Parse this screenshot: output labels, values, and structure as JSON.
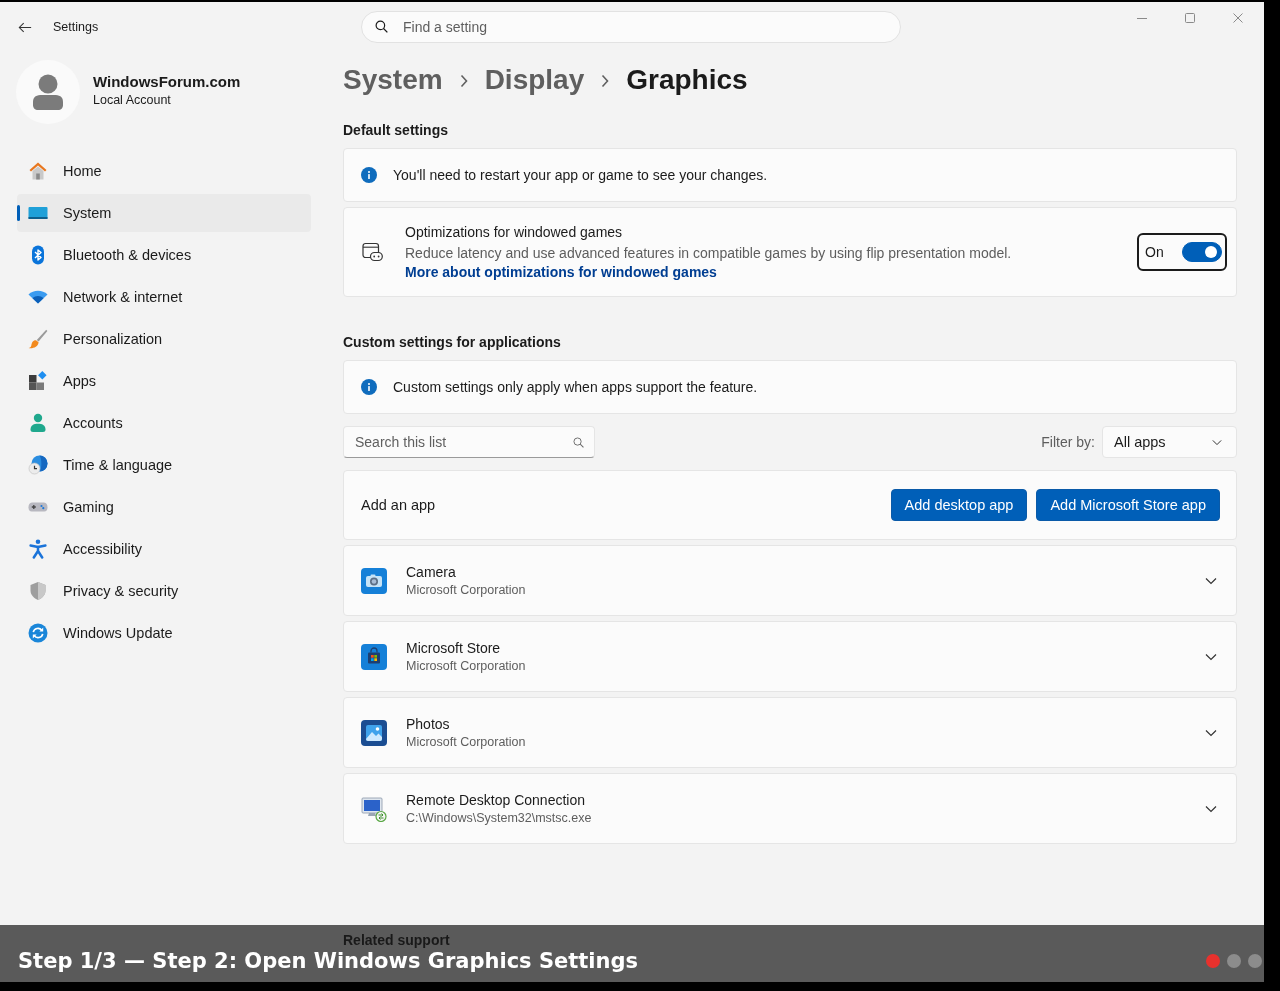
{
  "window": {
    "title": "Settings",
    "search": {
      "placeholder": "Find a setting"
    }
  },
  "account": {
    "name": "WindowsForum.com",
    "type": "Local Account"
  },
  "sidebar": {
    "items": [
      {
        "label": "Home",
        "selected": false
      },
      {
        "label": "System",
        "selected": true
      },
      {
        "label": "Bluetooth & devices",
        "selected": false
      },
      {
        "label": "Network & internet",
        "selected": false
      },
      {
        "label": "Personalization",
        "selected": false
      },
      {
        "label": "Apps",
        "selected": false
      },
      {
        "label": "Accounts",
        "selected": false
      },
      {
        "label": "Time & language",
        "selected": false
      },
      {
        "label": "Gaming",
        "selected": false
      },
      {
        "label": "Accessibility",
        "selected": false
      },
      {
        "label": "Privacy & security",
        "selected": false
      },
      {
        "label": "Windows Update",
        "selected": false
      }
    ]
  },
  "breadcrumb": [
    {
      "label": "System",
      "current": false
    },
    {
      "label": "Display",
      "current": false
    },
    {
      "label": "Graphics",
      "current": true
    }
  ],
  "default_settings": {
    "heading": "Default settings",
    "notice": "You'll need to restart your app or game to see your changes.",
    "setting": {
      "title": "Optimizations for windowed games",
      "description": "Reduce latency and use advanced features in compatible games by using flip presentation model.",
      "link": "More about optimizations for windowed games",
      "toggle": {
        "label": "On",
        "on": true,
        "focused": true
      }
    }
  },
  "custom_settings": {
    "heading": "Custom settings for applications",
    "notice": "Custom settings only apply when apps support the feature.",
    "search": {
      "placeholder": "Search this list"
    },
    "filter": {
      "label": "Filter by:",
      "value": "All apps"
    },
    "add_app": {
      "label": "Add an app",
      "buttons": [
        "Add desktop app",
        "Add Microsoft Store app"
      ]
    },
    "apps": [
      {
        "name": "Camera",
        "detail": "Microsoft Corporation",
        "expanded": false
      },
      {
        "name": "Microsoft Store",
        "detail": "Microsoft Corporation",
        "expanded": false
      },
      {
        "name": "Photos",
        "detail": "Microsoft Corporation",
        "expanded": false
      },
      {
        "name": "Remote Desktop Connection",
        "detail": "C:\\Windows\\System32\\mstsc.exe",
        "expanded": false
      }
    ]
  },
  "related_support": {
    "heading": "Related support"
  },
  "caption": {
    "text": "Step 1/3 — Step 2: Open Windows Graphics Settings",
    "steps": [
      {
        "selected": true
      },
      {
        "selected": false
      },
      {
        "selected": false
      }
    ]
  }
}
